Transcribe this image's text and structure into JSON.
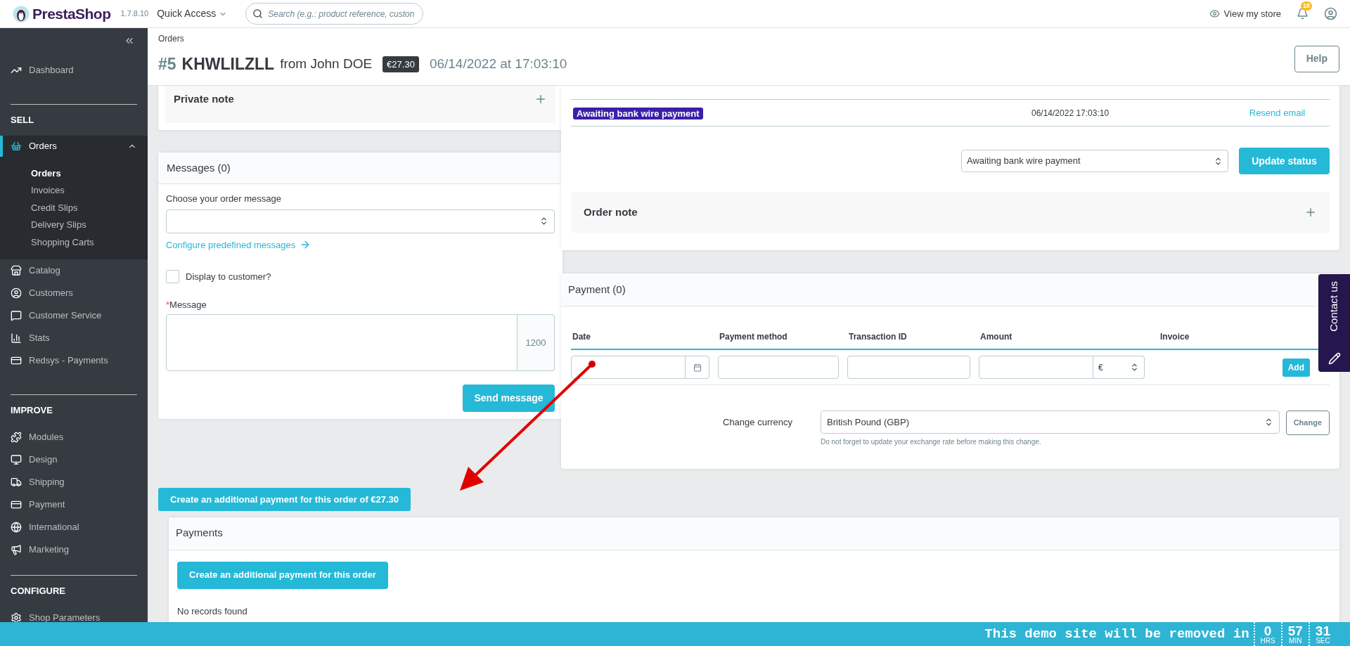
{
  "header": {
    "logo": "PrestaShop",
    "version": "1.7.8.10",
    "quick_access": "Quick Access",
    "search": {
      "placeholder": "Search (e.g.: product reference, custon"
    },
    "view_store": "View my store",
    "notifications": "18"
  },
  "sidebar": {
    "dashboard": {
      "label": "Dashboard",
      "selected": false
    },
    "sections": [
      {
        "title": "SELL",
        "items": [
          {
            "label": "Orders",
            "selected": true,
            "expanded": true,
            "children": [
              {
                "label": "Orders",
                "selected": true
              },
              {
                "label": "Invoices",
                "selected": false
              },
              {
                "label": "Credit Slips",
                "selected": false
              },
              {
                "label": "Delivery Slips",
                "selected": false
              },
              {
                "label": "Shopping Carts",
                "selected": false
              }
            ]
          },
          {
            "label": "Catalog",
            "selected": false,
            "expanded": false
          },
          {
            "label": "Customers",
            "selected": false,
            "expanded": false
          },
          {
            "label": "Customer Service",
            "selected": false,
            "expanded": false
          },
          {
            "label": "Stats",
            "selected": false,
            "expanded": false
          },
          {
            "label": "Redsys - Payments",
            "selected": false,
            "expanded": false
          }
        ]
      },
      {
        "title": "IMPROVE",
        "items": [
          {
            "label": "Modules",
            "selected": false,
            "expanded": false
          },
          {
            "label": "Design",
            "selected": false,
            "expanded": false
          },
          {
            "label": "Shipping",
            "selected": false,
            "expanded": false
          },
          {
            "label": "Payment",
            "selected": false,
            "expanded": false
          },
          {
            "label": "International",
            "selected": false,
            "expanded": false
          },
          {
            "label": "Marketing",
            "selected": false,
            "expanded": false
          }
        ]
      },
      {
        "title": "CONFIGURE",
        "items": [
          {
            "label": "Shop Parameters",
            "selected": false,
            "expanded": false
          }
        ]
      }
    ]
  },
  "page_header": {
    "breadcrumb": "Orders",
    "number": "#5",
    "reference": "KHWLILZLL",
    "from": "from John DOE",
    "total": "€27.30",
    "date": "06/14/2022 at 17:03:10",
    "help": "Help"
  },
  "private_note": {
    "title": "Private note"
  },
  "messages": {
    "title": "Messages (0)",
    "select_label": "Choose your order message",
    "configure_link": "Configure predefined messages",
    "display_checkbox": {
      "label": "Display to customer?",
      "checked": false
    },
    "required_mark": "*",
    "message_label": "Message",
    "counter": "1200",
    "send_button": "Send message"
  },
  "status_history": {
    "rows": [
      {
        "status": "Awaiting bank wire payment",
        "color": "#3b1fa8",
        "date": "06/14/2022 17:03:10",
        "action": "Resend email"
      }
    ],
    "status_select": "Awaiting bank wire payment",
    "update_button": "Update status",
    "order_note": "Order note"
  },
  "payment": {
    "title": "Payment (0)",
    "columns": [
      "Date",
      "Payment method",
      "Transaction ID",
      "Amount",
      "Invoice"
    ],
    "currency_symbol": "€",
    "add_button": "Add",
    "change_currency_label": "Change currency",
    "currency_select": "British Pound (GBP)",
    "change_button": "Change",
    "hint": "Do not forget to update your exchange rate before making this change."
  },
  "additional_payment_button": "Create an additional payment for this order of €27.30",
  "payments": {
    "title": "Payments",
    "button": "Create an additional payment for this order",
    "empty": "No records found"
  },
  "contact_tab": "Contact us",
  "demo_banner": {
    "text": "This demo site will be removed in",
    "countdown": [
      {
        "value": "0",
        "unit": "HRS"
      },
      {
        "value": "57",
        "unit": "MIN"
      },
      {
        "value": "31",
        "unit": "SEC"
      }
    ]
  }
}
